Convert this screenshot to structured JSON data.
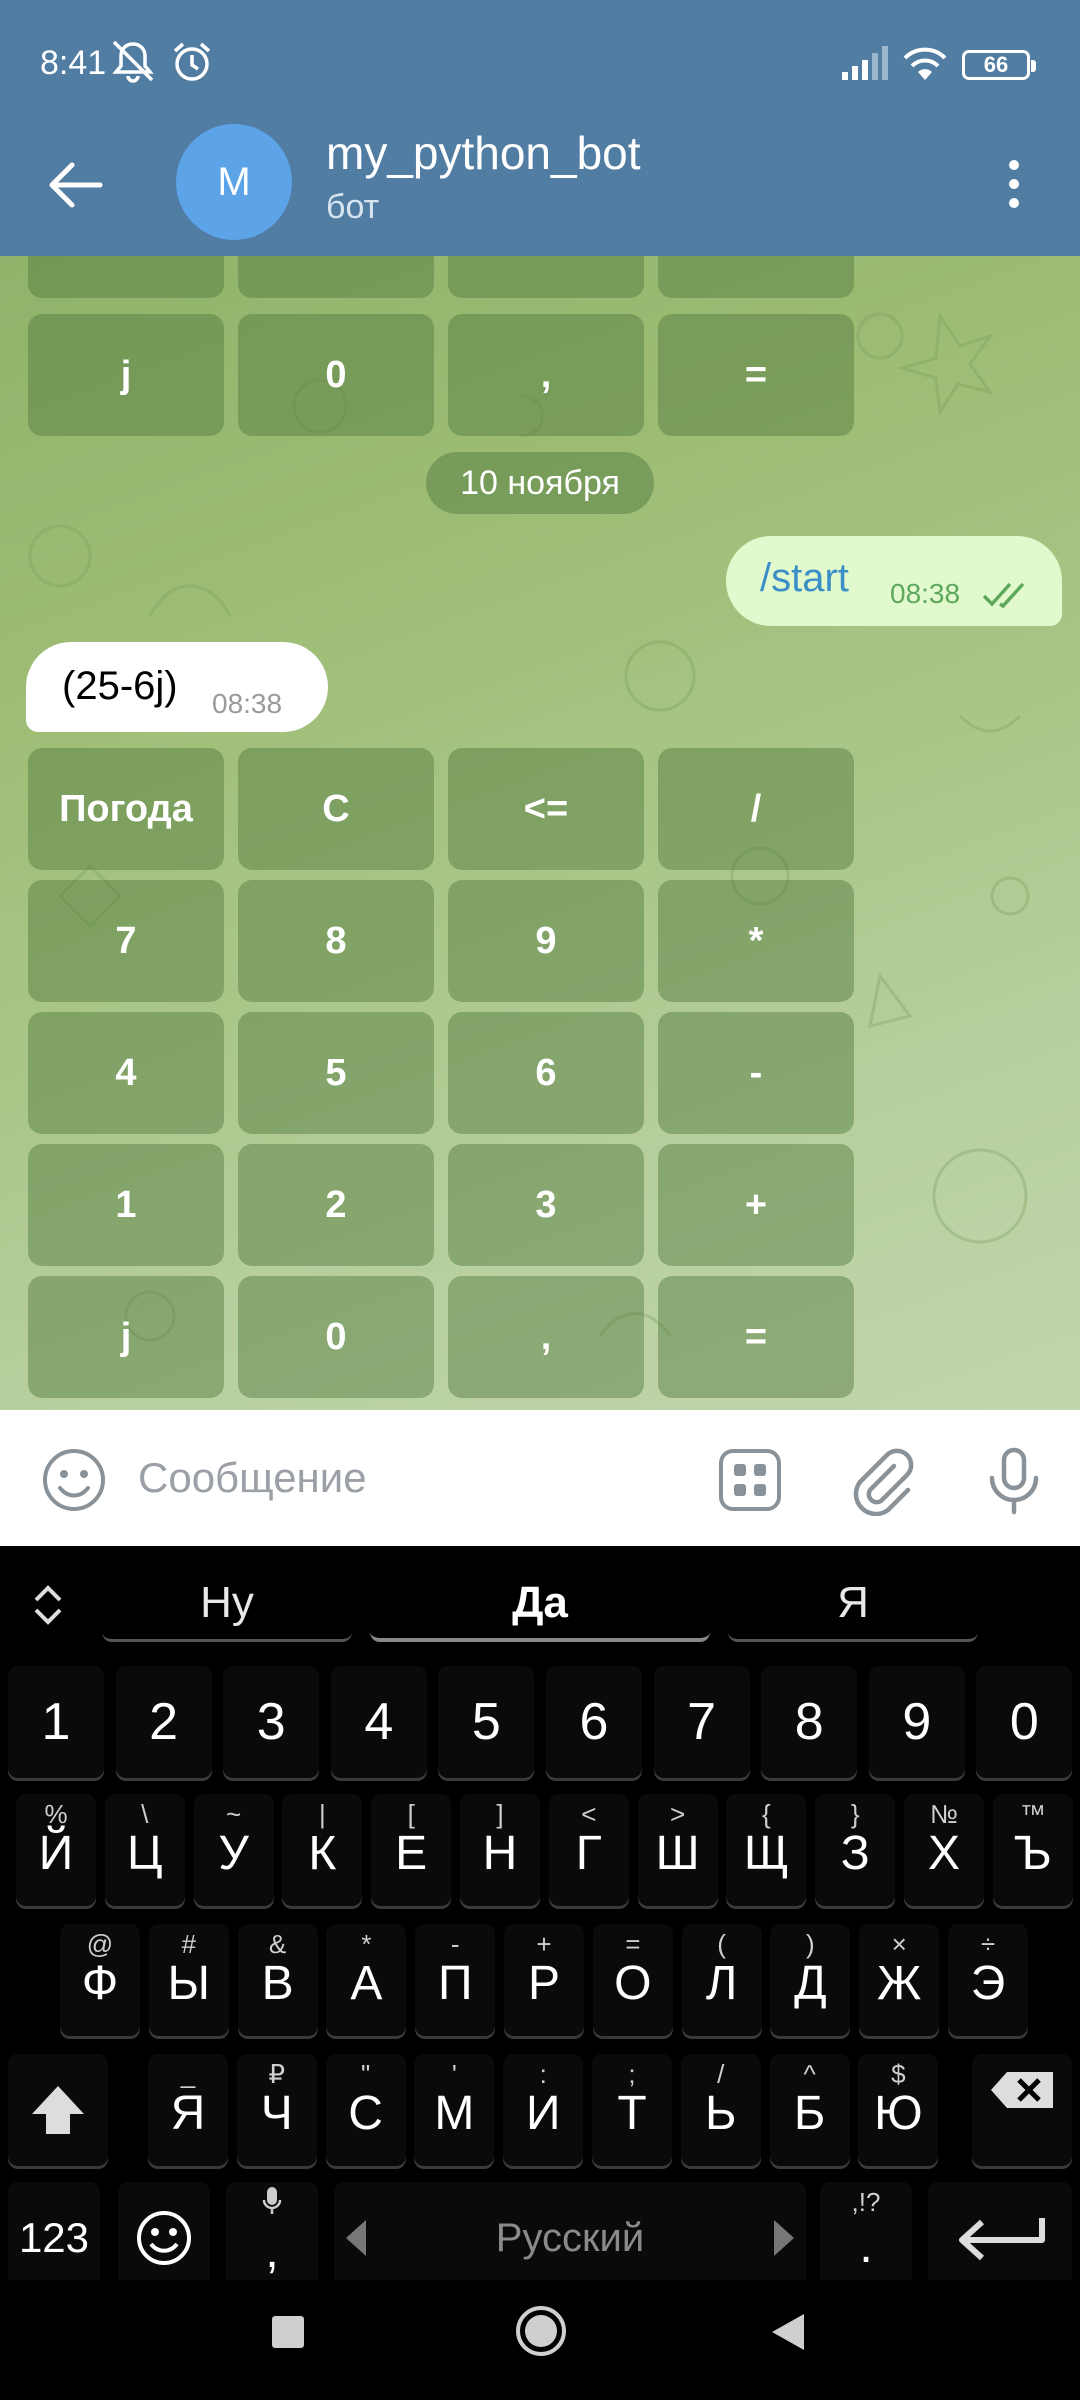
{
  "status_bar": {
    "time": "8:41",
    "battery": "66",
    "icons": [
      "mute-icon",
      "alarm-icon",
      "signal-icon",
      "wifi-icon",
      "battery-icon"
    ]
  },
  "header": {
    "avatar_letter": "M",
    "title": "my_python_bot",
    "subtitle": "бот",
    "colors": {
      "bar": "#517DA2",
      "avatar": "#5CA3E8"
    }
  },
  "chat": {
    "top_keyboard": {
      "partial_row": [
        "",
        "",
        "",
        ""
      ],
      "last_row": [
        "j",
        "0",
        ",",
        "="
      ]
    },
    "date": "10 ноября",
    "outgoing": {
      "text": "/start",
      "time": "08:38"
    },
    "incoming": {
      "text": "(25-6j)",
      "time": "08:38"
    },
    "reply_keyboard": [
      [
        "Погода",
        "C",
        "<=",
        "/"
      ],
      [
        "7",
        "8",
        "9",
        "*"
      ],
      [
        "4",
        "5",
        "6",
        "-"
      ],
      [
        "1",
        "2",
        "3",
        "+"
      ],
      [
        "j",
        "0",
        ",",
        "="
      ]
    ]
  },
  "input": {
    "placeholder": "Сообщение"
  },
  "keyboard": {
    "suggestions": [
      "Ну",
      "Да",
      "Я"
    ],
    "numbers": [
      "1",
      "2",
      "3",
      "4",
      "5",
      "6",
      "7",
      "8",
      "9",
      "0"
    ],
    "row1": [
      {
        "k": "Й",
        "h": "%"
      },
      {
        "k": "Ц",
        "h": "\\"
      },
      {
        "k": "У",
        "h": "~"
      },
      {
        "k": "К",
        "h": "|"
      },
      {
        "k": "Е",
        "h": "["
      },
      {
        "k": "Н",
        "h": "]"
      },
      {
        "k": "Г",
        "h": "<"
      },
      {
        "k": "Ш",
        "h": ">"
      },
      {
        "k": "Щ",
        "h": "{"
      },
      {
        "k": "З",
        "h": "}"
      },
      {
        "k": "Х",
        "h": "№"
      },
      {
        "k": "Ъ",
        "h": "™"
      }
    ],
    "row2": [
      {
        "k": "Ф",
        "h": "@"
      },
      {
        "k": "Ы",
        "h": "#"
      },
      {
        "k": "В",
        "h": "&"
      },
      {
        "k": "А",
        "h": "*"
      },
      {
        "k": "П",
        "h": "-"
      },
      {
        "k": "Р",
        "h": "+"
      },
      {
        "k": "О",
        "h": "="
      },
      {
        "k": "Л",
        "h": "("
      },
      {
        "k": "Д",
        "h": ")"
      },
      {
        "k": "Ж",
        "h": "×"
      },
      {
        "k": "Э",
        "h": "÷"
      }
    ],
    "row3": [
      {
        "k": "Я",
        "h": "_"
      },
      {
        "k": "Ч",
        "h": "₽"
      },
      {
        "k": "С",
        "h": "\""
      },
      {
        "k": "М",
        "h": "'"
      },
      {
        "k": "И",
        "h": ":"
      },
      {
        "k": "Т",
        "h": ";"
      },
      {
        "k": "Ь",
        "h": "/"
      },
      {
        "k": "Б",
        "h": "^"
      },
      {
        "k": "Ю",
        "h": "$"
      }
    ],
    "bottom": {
      "num_label": "123",
      "comma": ",",
      "space_label": "Русский",
      "period": ".",
      "period_hint": ",!?"
    }
  }
}
